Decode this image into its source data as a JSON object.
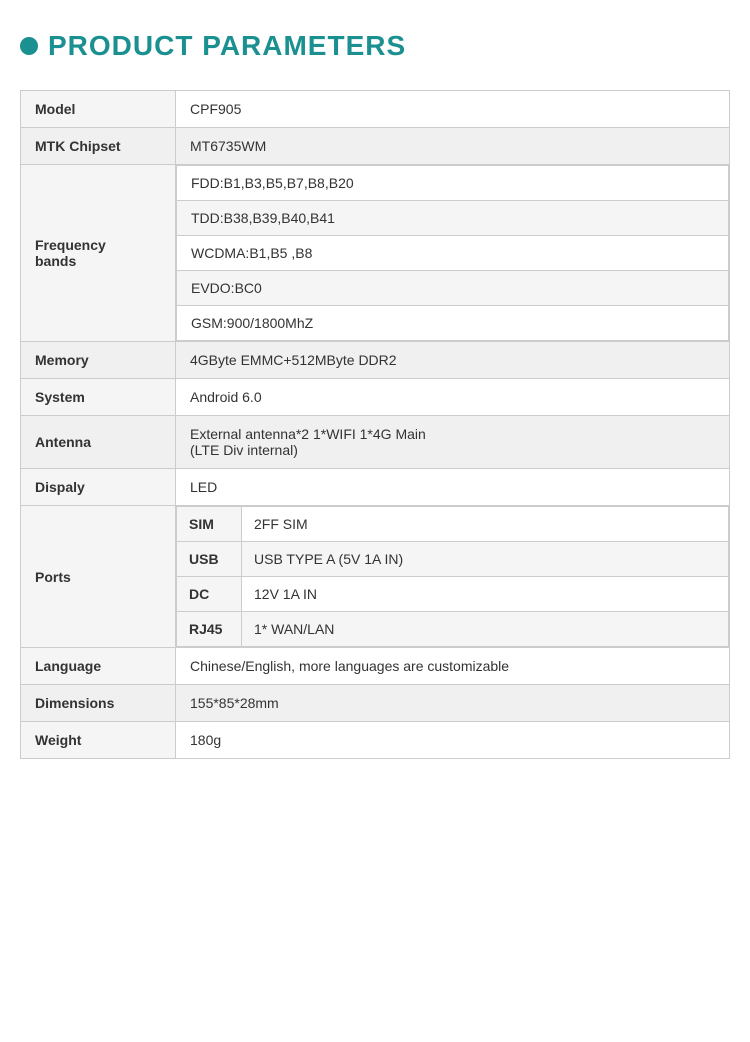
{
  "header": {
    "bullet": "•",
    "title": "PRODUCT PARAMETERS"
  },
  "table": {
    "rows": [
      {
        "label": "Model",
        "value": "CPF905",
        "type": "simple"
      },
      {
        "label": "MTK Chipset",
        "value": "MT6735WM",
        "type": "simple"
      },
      {
        "label": "Frequency\nbands",
        "type": "frequency",
        "values": [
          "FDD:B1,B3,B5,B7,B8,B20",
          "TDD:B38,B39,B40,B41",
          "WCDMA:B1,B5 ,B8",
          "EVDO:BC0",
          "GSM:900/1800MhZ"
        ]
      },
      {
        "label": "Memory",
        "value": "4GByte EMMC+512MByte DDR2",
        "type": "simple"
      },
      {
        "label": "System",
        "value": "Android 6.0",
        "type": "simple"
      },
      {
        "label": "Antenna",
        "value": "External antenna*2    1*WIFI  1*4G Main\n  (LTE Div internal)",
        "type": "multiline"
      },
      {
        "label": "Dispaly",
        "value": "LED",
        "type": "simple"
      },
      {
        "label": "Ports",
        "type": "ports",
        "ports": [
          {
            "sub_label": "SIM",
            "sub_value": "2FF SIM"
          },
          {
            "sub_label": "USB",
            "sub_value": "USB TYPE A (5V 1A IN)"
          },
          {
            "sub_label": "DC",
            "sub_value": "12V  1A IN"
          },
          {
            "sub_label": "RJ45",
            "sub_value": "1* WAN/LAN"
          }
        ]
      },
      {
        "label": "Language",
        "value": "Chinese/English, more languages are customizable",
        "type": "simple"
      },
      {
        "label": "Dimensions",
        "value": "155*85*28mm",
        "type": "simple"
      },
      {
        "label": "Weight",
        "value": "180g",
        "type": "simple"
      }
    ]
  }
}
